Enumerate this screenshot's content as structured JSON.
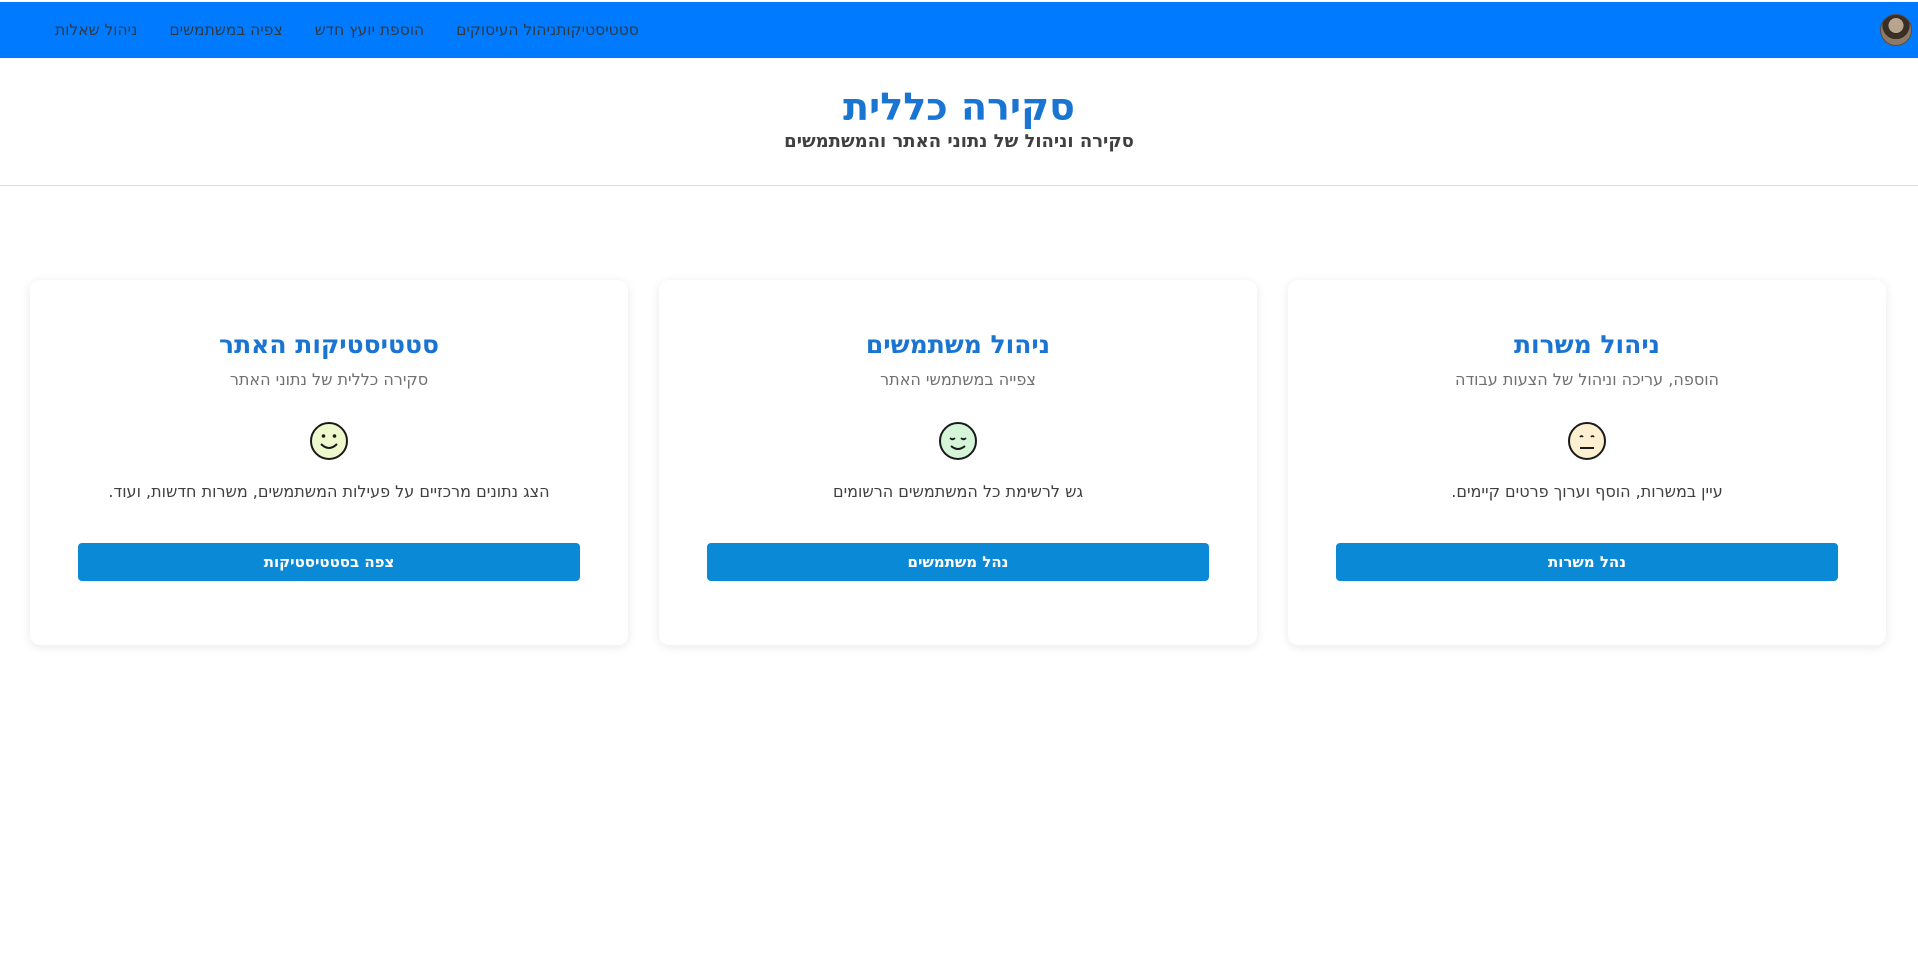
{
  "nav": {
    "links": [
      "סטטיסטיקות",
      "ניהול העיסוקים",
      "הוספת יועץ חדש",
      "צפיה במשתמשים",
      "ניהול שאלות"
    ]
  },
  "header": {
    "title": "סקירה כללית",
    "subtitle": "סקירה וניהול של נתוני האתר והמשתמשים"
  },
  "cards": [
    {
      "title": "ניהול משרות",
      "subtitle": "הוספה, עריכה וניהול של הצעות עבודה",
      "icon": "neutral-face-icon",
      "description": "עיין במשרות, הוסף וערוך פרטים קיימים.",
      "button": "נהל משרות",
      "icon_color": "#fdf0d0"
    },
    {
      "title": "ניהול משתמשים",
      "subtitle": "צפייה במשתמשי האתר",
      "icon": "content-face-icon",
      "description": "גש לרשימת כל המשתמשים הרשומים",
      "button": "נהל משתמשים",
      "icon_color": "#d4f5d8"
    },
    {
      "title": "סטטיסטיקות האתר",
      "subtitle": "סקירה כללית של נתוני האתר",
      "icon": "smiling-face-icon",
      "description": "הצג נתונים מרכזיים על פעילות המשתמשים, משרות חדשות, ועוד.",
      "button": "צפה בסטטיסטיקות",
      "icon_color": "#eef8cc"
    }
  ],
  "colors": {
    "navbar": "#007bff",
    "accent": "#1a74d2",
    "button": "#0a89d6"
  }
}
